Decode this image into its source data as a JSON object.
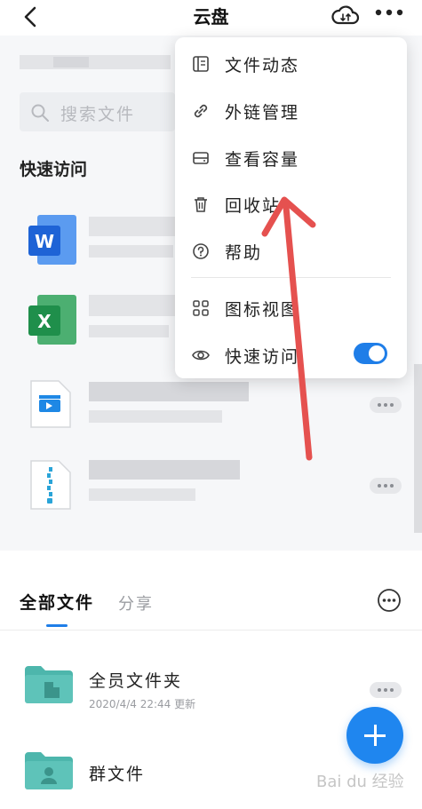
{
  "header": {
    "title": "云盘",
    "back_icon": "chevron-left-icon",
    "cloud_icon": "cloud-transfer-icon",
    "more_icon": "more-horizontal-icon"
  },
  "search": {
    "placeholder": "搜索文件"
  },
  "quick_access": {
    "title": "快速访问"
  },
  "menu": {
    "items": [
      {
        "label": "文件动态",
        "icon": "file-activity-icon"
      },
      {
        "label": "外链管理",
        "icon": "link-icon"
      },
      {
        "label": "查看容量",
        "icon": "storage-icon"
      },
      {
        "label": "回收站",
        "icon": "trash-icon"
      },
      {
        "label": "帮助",
        "icon": "help-icon"
      },
      {
        "label": "图标视图",
        "icon": "grid-view-icon"
      },
      {
        "label": "快速访问",
        "icon": "eye-icon",
        "toggle_on": true
      }
    ]
  },
  "tabs": {
    "all_files": "全部文件",
    "share": "分享"
  },
  "files": [
    {
      "name": "全员文件夹",
      "meta": "2020/4/4 22:44 更新"
    },
    {
      "name": "群文件",
      "meta": ""
    }
  ],
  "watermark": "Bai du 经验",
  "colors": {
    "accent": "#1f7ee8",
    "arrow": "#e5514f",
    "folder": "#4db6ac"
  }
}
